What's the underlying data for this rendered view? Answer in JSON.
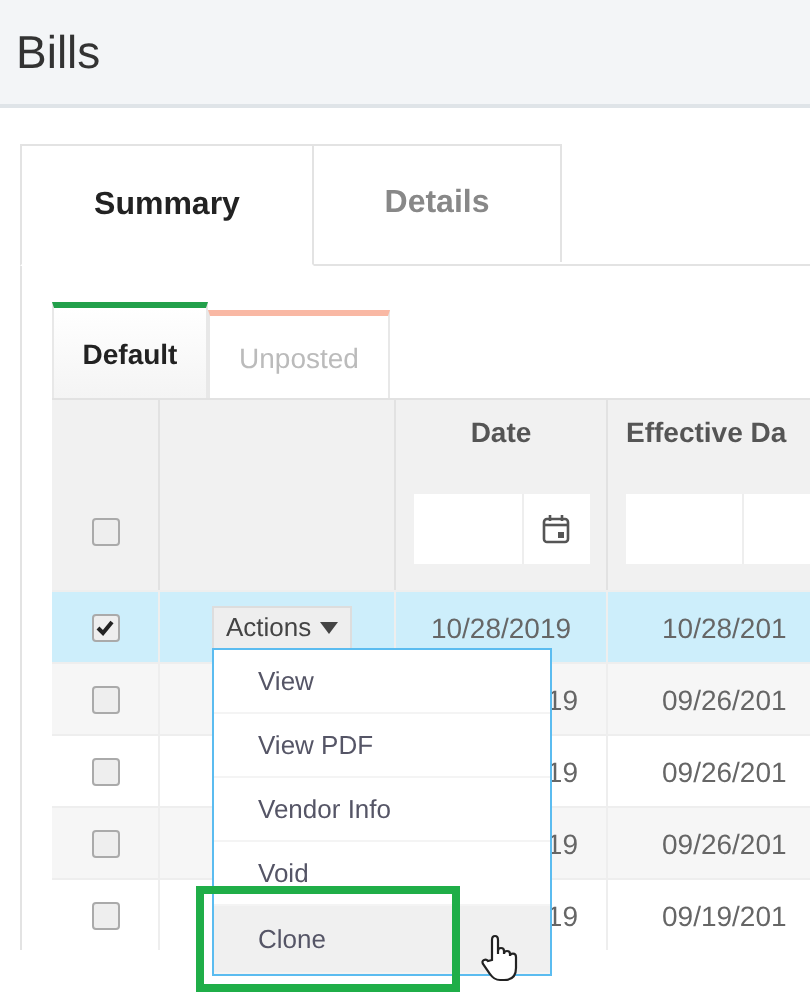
{
  "page": {
    "title": "Bills"
  },
  "tabs": [
    {
      "label": "Summary",
      "selected": true
    },
    {
      "label": "Details",
      "selected": false
    }
  ],
  "subtabs": [
    {
      "label": "Default",
      "selected": true,
      "color": "#22a04b"
    },
    {
      "label": "Unposted",
      "selected": false,
      "color": "#f9b8a4"
    }
  ],
  "table": {
    "header_checkbox": {
      "checked": false
    },
    "columns": [
      {
        "label": "Date"
      },
      {
        "label": "Effective Da"
      }
    ],
    "rows": [
      {
        "selected": true,
        "checked": true,
        "action": "Actions",
        "date": "10/28/2019",
        "effective_date": "10/28/201"
      },
      {
        "selected": false,
        "checked": false,
        "date": "19",
        "effective_date": "09/26/201"
      },
      {
        "selected": false,
        "checked": false,
        "date": "19",
        "effective_date": "09/26/201"
      },
      {
        "selected": false,
        "checked": false,
        "date": "19",
        "effective_date": "09/26/201"
      },
      {
        "selected": false,
        "checked": false,
        "date": "19",
        "effective_date": "09/19/201"
      }
    ]
  },
  "actions_menu": {
    "items": [
      {
        "label": "View",
        "hovered": false,
        "framed": false
      },
      {
        "label": "View PDF",
        "hovered": false,
        "framed": false
      },
      {
        "label": "Vendor Info",
        "hovered": false,
        "framed": false
      },
      {
        "label": "Void",
        "hovered": false,
        "framed": false
      },
      {
        "label": "Clone",
        "hovered": true,
        "framed": true
      }
    ]
  }
}
